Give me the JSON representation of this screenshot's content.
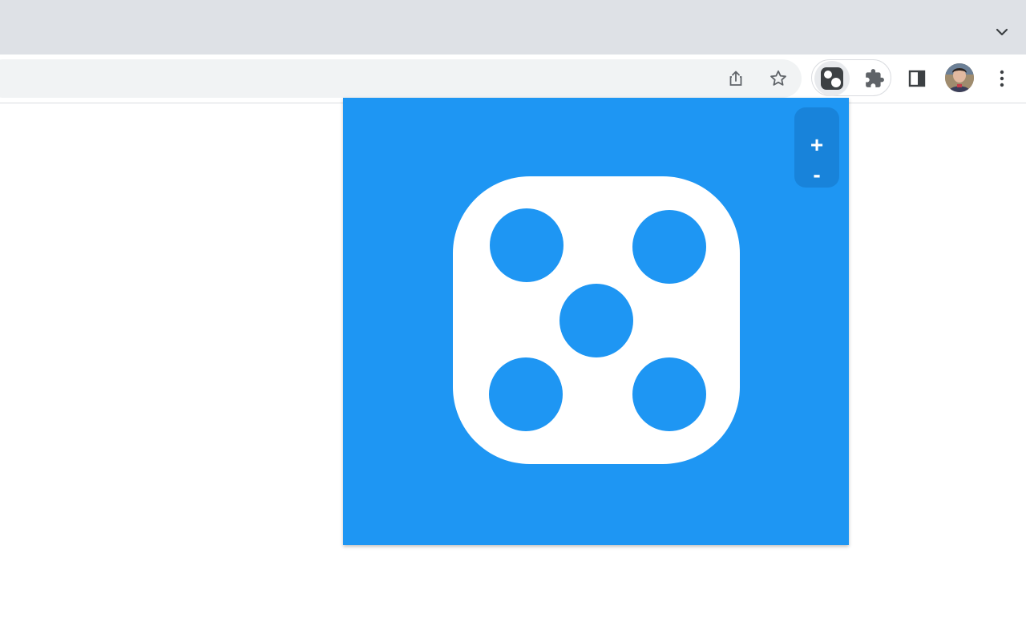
{
  "browser": {
    "tab_search_icon": "chevron-down-icon",
    "toolbar": {
      "share_icon": "share-icon",
      "bookmark_icon": "star-icon",
      "active_extension_icon": "dice-extension-icon",
      "extensions_icon": "puzzle-icon",
      "side_panel_icon": "side-panel-icon",
      "profile_icon": "avatar",
      "menu_icon": "kebab-menu-icon"
    }
  },
  "popup": {
    "background_color": "#1e96f3",
    "zoom_in_label": "+",
    "zoom_out_label": "-",
    "die_face": 5
  }
}
